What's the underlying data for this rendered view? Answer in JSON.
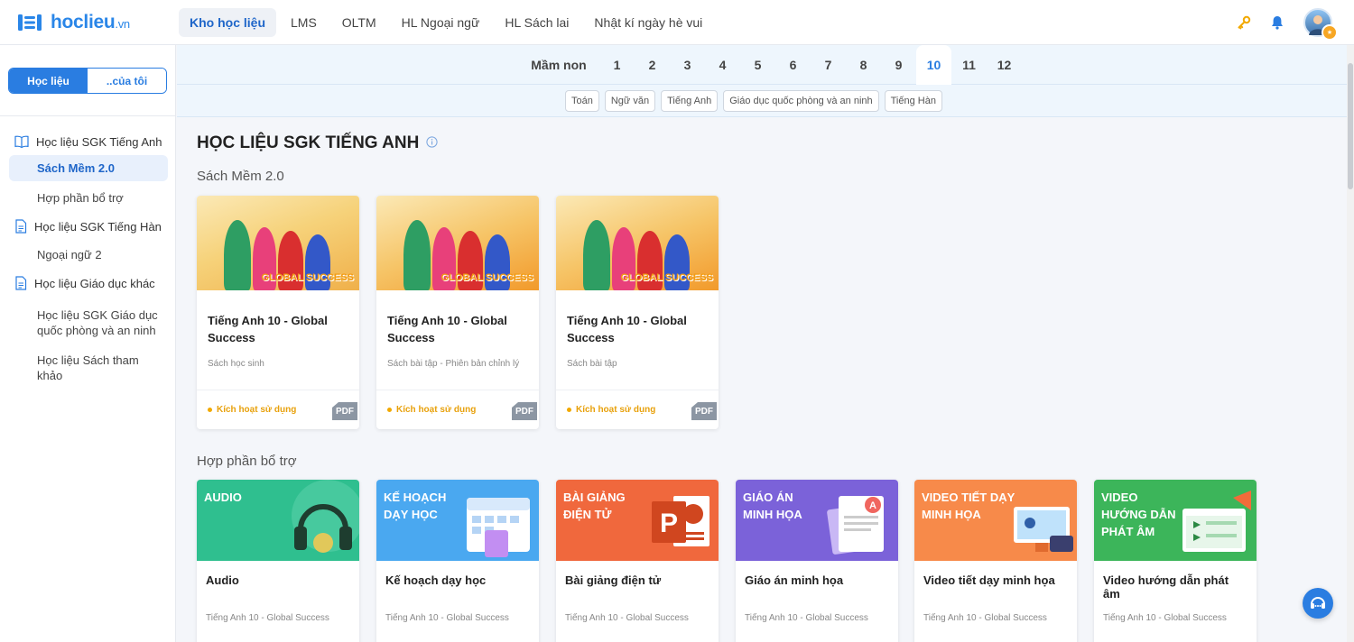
{
  "brand": {
    "name": "hoclieu",
    "tld": ".vn",
    "color": "#2a86e8"
  },
  "nav": {
    "items": [
      {
        "label": "Kho học liệu",
        "active": true
      },
      {
        "label": "LMS"
      },
      {
        "label": "OLTM"
      },
      {
        "label": "HL Ngoại ngữ"
      },
      {
        "label": "HL Sách lai"
      },
      {
        "label": "Nhật kí ngày hè vui"
      }
    ],
    "icons": [
      "key-icon",
      "bell-icon",
      "avatar"
    ]
  },
  "sidebar": {
    "segments": [
      {
        "label": "Học liệu",
        "active": true
      },
      {
        "label": "..của tôi"
      }
    ],
    "menu": [
      {
        "type": "group",
        "label": "Học liệu SGK Tiếng Anh",
        "icon": "book-icon"
      },
      {
        "type": "sub",
        "label": "Sách Mềm 2.0",
        "active": true
      },
      {
        "type": "sub",
        "label": "Hợp phần bổ trợ"
      },
      {
        "type": "group",
        "label": "Học liệu SGK Tiếng Hàn",
        "icon": "document-icon"
      },
      {
        "type": "sub",
        "label": "Ngoại ngữ 2"
      },
      {
        "type": "group",
        "label": "Học liệu Giáo dục khác",
        "icon": "document-icon"
      },
      {
        "type": "sub",
        "label": "Học liệu SGK Giáo dục quốc phòng và an ninh"
      },
      {
        "type": "sub",
        "label": "Học liệu Sách tham khảo"
      }
    ]
  },
  "grades": {
    "items": [
      "Mầm non",
      "1",
      "2",
      "3",
      "4",
      "5",
      "6",
      "7",
      "8",
      "9",
      "10",
      "11",
      "12"
    ],
    "active": "10"
  },
  "subjects": [
    "Toán",
    "Ngữ văn",
    "Tiếng Anh",
    "Giáo dục quốc phòng và an ninh",
    "Tiếng Hàn"
  ],
  "main": {
    "title": "HỌC LIỆU SGK TIẾNG ANH",
    "sections": [
      {
        "title": "Sách Mềm 2.0",
        "cards": [
          {
            "title": "Tiếng Anh 10 - Global Success",
            "subtitle": "Sách học sinh",
            "status": "Kích hoạt sử dụng",
            "badge": "PDF",
            "cover_text": "GLOBAL SUCCESS"
          },
          {
            "title": "Tiếng Anh 10 - Global Success",
            "subtitle": "Sách bài tập - Phiên bản chỉnh lý",
            "status": "Kích hoạt sử dụng",
            "badge": "PDF",
            "cover_text": "GLOBAL SUCCESS"
          },
          {
            "title": "Tiếng Anh 10 - Global Success",
            "subtitle": "Sách bài tập",
            "status": "Kích hoạt sử dụng",
            "badge": "PDF",
            "cover_text": "GLOBAL SUCCESS"
          }
        ]
      },
      {
        "title": "Hợp phần bổ trợ",
        "cards": [
          {
            "banner": "AUDIO",
            "title": "Audio",
            "subtitle": "Tiếng Anh 10 - Global Success",
            "color": "#2fbf8f"
          },
          {
            "banner": "KẾ HOẠCH DẠY HỌC",
            "title": "Kế hoạch dạy học",
            "subtitle": "Tiếng Anh 10 - Global Success",
            "color": "#4aa8f0"
          },
          {
            "banner": "BÀI GIẢNG ĐIỆN TỬ",
            "title": "Bài giảng điện tử",
            "subtitle": "Tiếng Anh 10 - Global Success",
            "color": "#f0683d"
          },
          {
            "banner": "GIÁO ÁN MINH HỌA",
            "title": "Giáo án minh họa",
            "subtitle": "Tiếng Anh 10 - Global Success",
            "color": "#7b62d9"
          },
          {
            "banner": "VIDEO TIẾT DẠY MINH HỌA",
            "title": "Video tiết dạy minh họa",
            "subtitle": "Tiếng Anh 10 - Global Success",
            "color": "#f78a4a"
          },
          {
            "banner": "VIDEO HƯỚNG DẪN PHÁT ÂM",
            "title": "Video hướng dẫn phát âm",
            "subtitle": "Tiếng Anh 10 - Global Success",
            "color": "#3cb55a"
          }
        ]
      }
    ]
  }
}
